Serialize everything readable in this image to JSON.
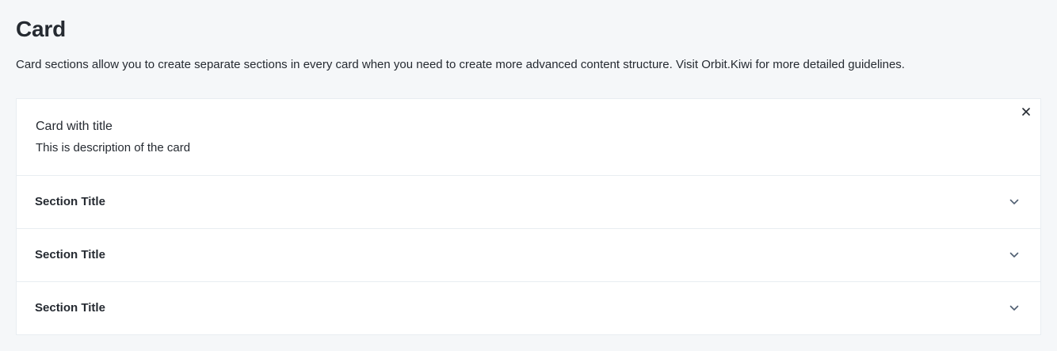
{
  "page": {
    "title": "Card",
    "description": "Card sections allow you to create separate sections in every card when you need to create more advanced content structure. Visit Orbit.Kiwi for more detailed guidelines."
  },
  "card": {
    "title": "Card with title",
    "description": "This is description of the card",
    "close_icon": "close-icon",
    "sections": [
      {
        "title": "Section Title",
        "icon": "chevron-down-icon"
      },
      {
        "title": "Section Title",
        "icon": "chevron-down-icon"
      },
      {
        "title": "Section Title",
        "icon": "chevron-down-icon"
      }
    ]
  },
  "colors": {
    "background": "#f5f7f9",
    "card_background": "#ffffff",
    "border": "#e8edf1",
    "text": "#252a31"
  }
}
